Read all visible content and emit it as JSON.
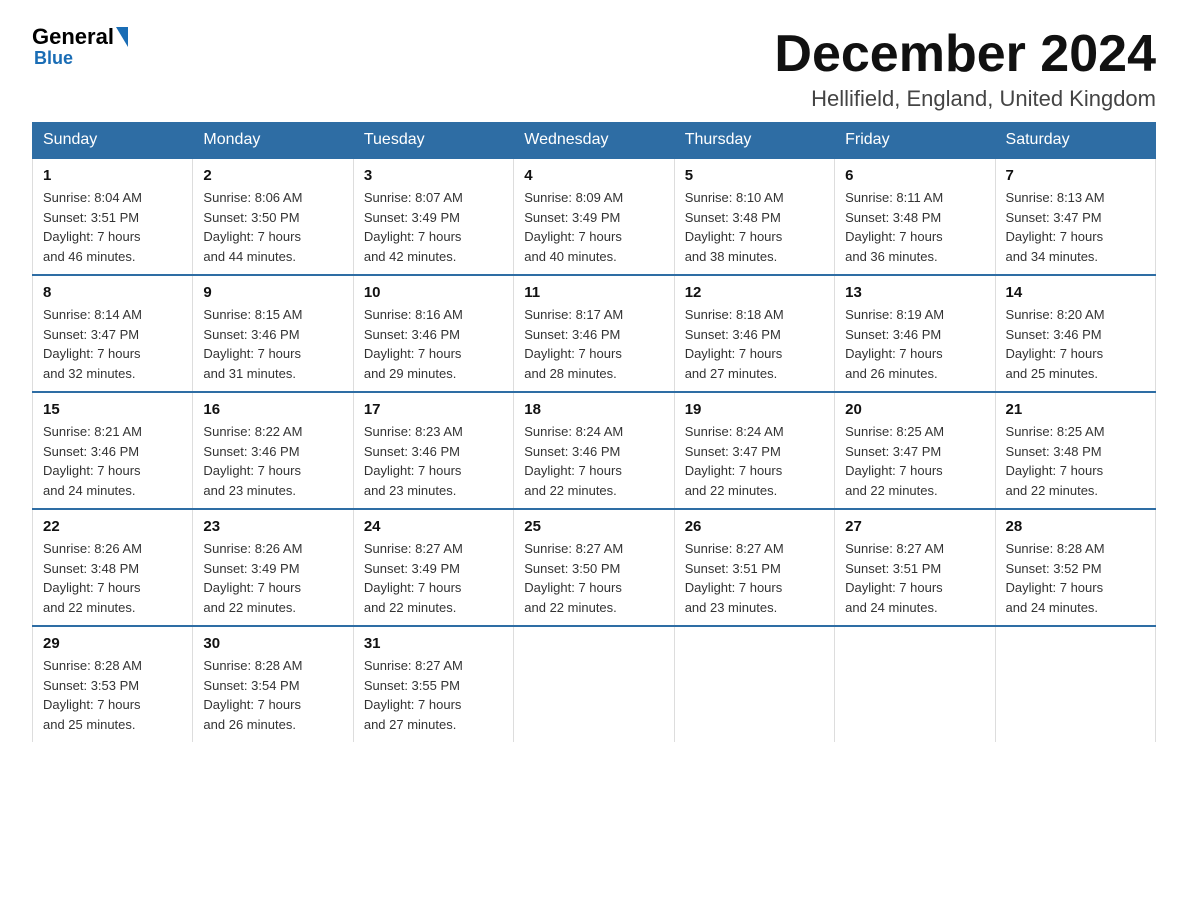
{
  "logo": {
    "general": "General",
    "blue": "Blue"
  },
  "header": {
    "month": "December 2024",
    "location": "Hellifield, England, United Kingdom"
  },
  "days_of_week": [
    "Sunday",
    "Monday",
    "Tuesday",
    "Wednesday",
    "Thursday",
    "Friday",
    "Saturday"
  ],
  "weeks": [
    [
      {
        "day": "1",
        "sunrise": "8:04 AM",
        "sunset": "3:51 PM",
        "daylight": "7 hours and 46 minutes."
      },
      {
        "day": "2",
        "sunrise": "8:06 AM",
        "sunset": "3:50 PM",
        "daylight": "7 hours and 44 minutes."
      },
      {
        "day": "3",
        "sunrise": "8:07 AM",
        "sunset": "3:49 PM",
        "daylight": "7 hours and 42 minutes."
      },
      {
        "day": "4",
        "sunrise": "8:09 AM",
        "sunset": "3:49 PM",
        "daylight": "7 hours and 40 minutes."
      },
      {
        "day": "5",
        "sunrise": "8:10 AM",
        "sunset": "3:48 PM",
        "daylight": "7 hours and 38 minutes."
      },
      {
        "day": "6",
        "sunrise": "8:11 AM",
        "sunset": "3:48 PM",
        "daylight": "7 hours and 36 minutes."
      },
      {
        "day": "7",
        "sunrise": "8:13 AM",
        "sunset": "3:47 PM",
        "daylight": "7 hours and 34 minutes."
      }
    ],
    [
      {
        "day": "8",
        "sunrise": "8:14 AM",
        "sunset": "3:47 PM",
        "daylight": "7 hours and 32 minutes."
      },
      {
        "day": "9",
        "sunrise": "8:15 AM",
        "sunset": "3:46 PM",
        "daylight": "7 hours and 31 minutes."
      },
      {
        "day": "10",
        "sunrise": "8:16 AM",
        "sunset": "3:46 PM",
        "daylight": "7 hours and 29 minutes."
      },
      {
        "day": "11",
        "sunrise": "8:17 AM",
        "sunset": "3:46 PM",
        "daylight": "7 hours and 28 minutes."
      },
      {
        "day": "12",
        "sunrise": "8:18 AM",
        "sunset": "3:46 PM",
        "daylight": "7 hours and 27 minutes."
      },
      {
        "day": "13",
        "sunrise": "8:19 AM",
        "sunset": "3:46 PM",
        "daylight": "7 hours and 26 minutes."
      },
      {
        "day": "14",
        "sunrise": "8:20 AM",
        "sunset": "3:46 PM",
        "daylight": "7 hours and 25 minutes."
      }
    ],
    [
      {
        "day": "15",
        "sunrise": "8:21 AM",
        "sunset": "3:46 PM",
        "daylight": "7 hours and 24 minutes."
      },
      {
        "day": "16",
        "sunrise": "8:22 AM",
        "sunset": "3:46 PM",
        "daylight": "7 hours and 23 minutes."
      },
      {
        "day": "17",
        "sunrise": "8:23 AM",
        "sunset": "3:46 PM",
        "daylight": "7 hours and 23 minutes."
      },
      {
        "day": "18",
        "sunrise": "8:24 AM",
        "sunset": "3:46 PM",
        "daylight": "7 hours and 22 minutes."
      },
      {
        "day": "19",
        "sunrise": "8:24 AM",
        "sunset": "3:47 PM",
        "daylight": "7 hours and 22 minutes."
      },
      {
        "day": "20",
        "sunrise": "8:25 AM",
        "sunset": "3:47 PM",
        "daylight": "7 hours and 22 minutes."
      },
      {
        "day": "21",
        "sunrise": "8:25 AM",
        "sunset": "3:48 PM",
        "daylight": "7 hours and 22 minutes."
      }
    ],
    [
      {
        "day": "22",
        "sunrise": "8:26 AM",
        "sunset": "3:48 PM",
        "daylight": "7 hours and 22 minutes."
      },
      {
        "day": "23",
        "sunrise": "8:26 AM",
        "sunset": "3:49 PM",
        "daylight": "7 hours and 22 minutes."
      },
      {
        "day": "24",
        "sunrise": "8:27 AM",
        "sunset": "3:49 PM",
        "daylight": "7 hours and 22 minutes."
      },
      {
        "day": "25",
        "sunrise": "8:27 AM",
        "sunset": "3:50 PM",
        "daylight": "7 hours and 22 minutes."
      },
      {
        "day": "26",
        "sunrise": "8:27 AM",
        "sunset": "3:51 PM",
        "daylight": "7 hours and 23 minutes."
      },
      {
        "day": "27",
        "sunrise": "8:27 AM",
        "sunset": "3:51 PM",
        "daylight": "7 hours and 24 minutes."
      },
      {
        "day": "28",
        "sunrise": "8:28 AM",
        "sunset": "3:52 PM",
        "daylight": "7 hours and 24 minutes."
      }
    ],
    [
      {
        "day": "29",
        "sunrise": "8:28 AM",
        "sunset": "3:53 PM",
        "daylight": "7 hours and 25 minutes."
      },
      {
        "day": "30",
        "sunrise": "8:28 AM",
        "sunset": "3:54 PM",
        "daylight": "7 hours and 26 minutes."
      },
      {
        "day": "31",
        "sunrise": "8:27 AM",
        "sunset": "3:55 PM",
        "daylight": "7 hours and 27 minutes."
      },
      null,
      null,
      null,
      null
    ]
  ],
  "labels": {
    "sunrise": "Sunrise:",
    "sunset": "Sunset:",
    "daylight": "Daylight:"
  }
}
